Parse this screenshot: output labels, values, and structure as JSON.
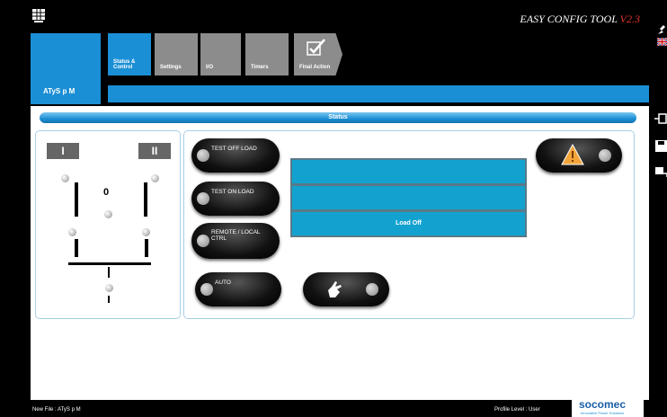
{
  "header": {
    "title": "EASY CONFIG TOOL",
    "version": "V2.3"
  },
  "device": {
    "label": "ATyS p M"
  },
  "tabs": [
    {
      "label": "Status & Control"
    },
    {
      "label": "Settings"
    },
    {
      "label": "I/O"
    },
    {
      "label": "Timers"
    },
    {
      "label": "Final Action"
    }
  ],
  "status": {
    "title": "Status"
  },
  "switch": {
    "left_label": "I",
    "right_label": "II",
    "position_label": "0"
  },
  "controls": {
    "test_off": "TEST OFF   LOAD",
    "test_on": "TEST ON   LOAD",
    "remote": "REMOTE / LOCAL",
    "remote_line2": "CTRL",
    "auto": "AUTO"
  },
  "display": {
    "row1": "",
    "row2": "",
    "row3": "Load Off"
  },
  "footer": {
    "file": "New File : ATyS p M",
    "profile": "Profile Level : User"
  },
  "brand": {
    "logo": "socomec",
    "tagline": "Innovative Power Solutions"
  },
  "colors": {
    "accent": "#1b8fd5",
    "tab_inactive": "#8c8c8c",
    "version": "#e0342a"
  }
}
